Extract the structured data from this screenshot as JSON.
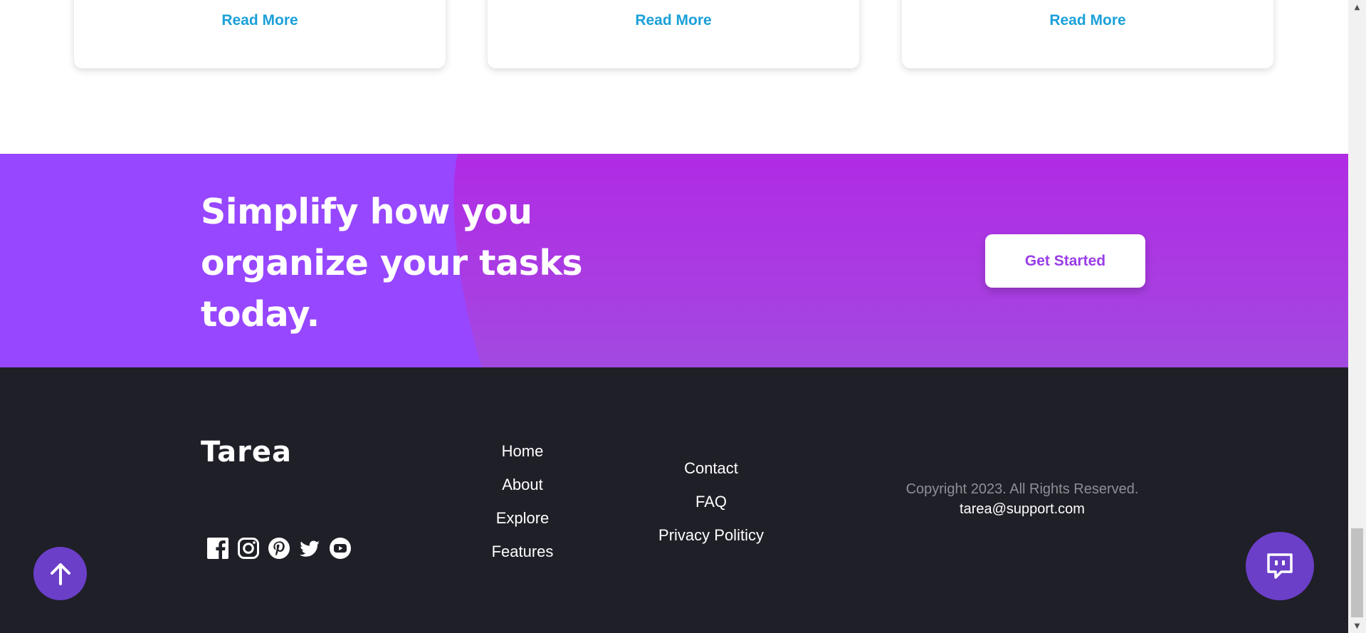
{
  "cards": {
    "read_more": [
      "Read More",
      "Read More",
      "Read More"
    ]
  },
  "cta": {
    "title": "Simplify how you organize your tasks today.",
    "button": "Get Started"
  },
  "footer": {
    "logo": "Tarea",
    "social_icons": [
      "facebook-icon",
      "instagram-icon",
      "pinterest-icon",
      "twitter-icon",
      "youtube-icon"
    ],
    "nav_col_1": [
      "Home",
      "About",
      "Explore",
      "Features"
    ],
    "nav_col_2": [
      "Contact",
      "FAQ",
      "Privacy Politicy"
    ],
    "copyright": "Copyright 2023. All Rights Reserved.",
    "email": "tarea@support.com"
  },
  "colors": {
    "link_blue": "#1ba0d8",
    "cta_purple": "#b02be4",
    "cta_light_purple": "#9747ff",
    "footer_bg": "#1f1f27",
    "floating_button": "#6b3fc8",
    "button_text": "#9a3ce6"
  }
}
